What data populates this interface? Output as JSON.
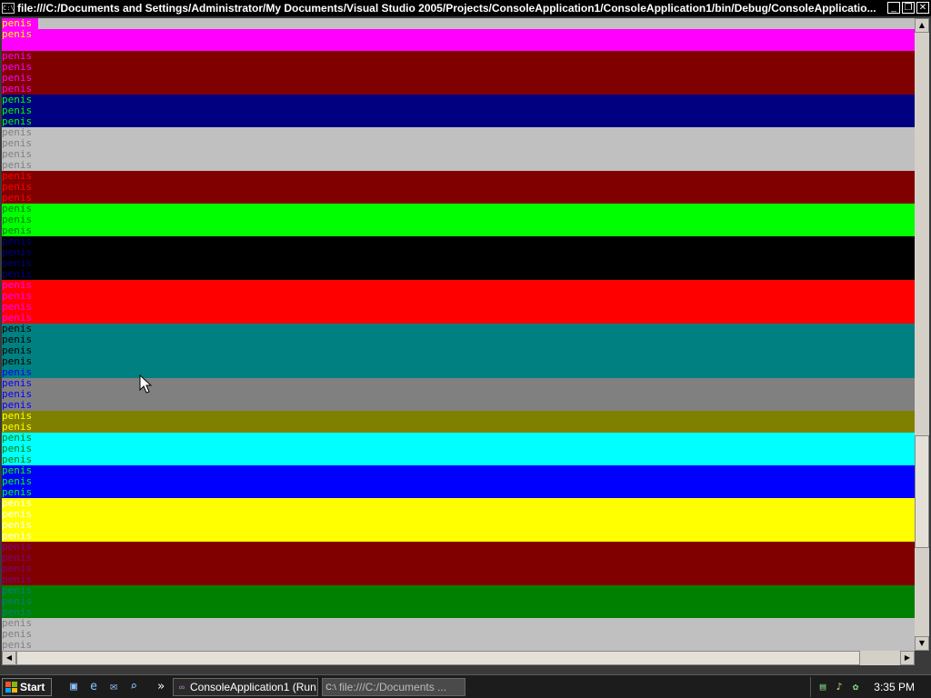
{
  "window": {
    "title": "file:///C:/Documents and Settings/Administrator/My Documents/Visual Studio 2005/Projects/ConsoleApplication1/ConsoleApplication1/bin/Debug/ConsoleApplicatio...",
    "icon": "console-icon",
    "icon_glyph": "C:\\",
    "buttons": {
      "minimize": "_",
      "restore": "❐",
      "close": "✕"
    }
  },
  "console": {
    "word": "penis",
    "start_row": 0,
    "bands": [
      {
        "color": "#c0c0c0",
        "lines": [
          {
            "fg": "#ffff00",
            "bg": "#ff00ff"
          }
        ]
      },
      {
        "color": "#ff00ff",
        "lines": [
          {
            "fg": "#ffff00",
            "bg": "#ff00ff"
          },
          {
            "fg": "#ff00ff",
            "bg": "#ff00ff"
          }
        ]
      },
      {
        "color": "#800000",
        "lines": [
          {
            "fg": "#ff00ff",
            "bg": "#800000"
          },
          {
            "fg": "#ff00ff",
            "bg": "#800000"
          },
          {
            "fg": "#ff00ff",
            "bg": "#800000"
          },
          {
            "fg": "#ff00ff",
            "bg": "#800000"
          }
        ]
      },
      {
        "color": "#000080",
        "lines": [
          {
            "fg": "#00ff00",
            "bg": "#000080"
          },
          {
            "fg": "#00ff00",
            "bg": "#000080"
          },
          {
            "fg": "#00ff00",
            "bg": "#000080"
          }
        ]
      },
      {
        "color": "#c0c0c0",
        "lines": [
          {
            "fg": "#808080",
            "bg": "#c0c0c0"
          },
          {
            "fg": "#808080",
            "bg": "#c0c0c0"
          },
          {
            "fg": "#808080",
            "bg": "#c0c0c0"
          },
          {
            "fg": "#808080",
            "bg": "#c0c0c0"
          }
        ]
      },
      {
        "color": "#800000",
        "lines": [
          {
            "fg": "#ff0000",
            "bg": "#800000"
          },
          {
            "fg": "#ff0000",
            "bg": "#800000"
          },
          {
            "fg": "#ff0000",
            "bg": "#800000"
          }
        ]
      },
      {
        "color": "#00ff00",
        "lines": [
          {
            "fg": "#008000",
            "bg": "#00ff00"
          },
          {
            "fg": "#008000",
            "bg": "#00ff00"
          },
          {
            "fg": "#008000",
            "bg": "#00ff00"
          }
        ]
      },
      {
        "color": "#000000",
        "lines": [
          {
            "fg": "#000080",
            "bg": "#000000"
          },
          {
            "fg": "#000080",
            "bg": "#000000"
          },
          {
            "fg": "#000080",
            "bg": "#000000"
          },
          {
            "fg": "#000080",
            "bg": "#000000"
          }
        ]
      },
      {
        "color": "#ff0000",
        "lines": [
          {
            "fg": "#ff00ff",
            "bg": "#ff0000"
          },
          {
            "fg": "#ff00ff",
            "bg": "#ff0000"
          },
          {
            "fg": "#ff00ff",
            "bg": "#ff0000"
          },
          {
            "fg": "#ff00ff",
            "bg": "#ff0000"
          }
        ]
      },
      {
        "color": "#008080",
        "lines": [
          {
            "fg": "#000000",
            "bg": "#008080"
          },
          {
            "fg": "#000000",
            "bg": "#008080"
          },
          {
            "fg": "#000000",
            "bg": "#008080"
          },
          {
            "fg": "#000000",
            "bg": "#008080"
          },
          {
            "fg": "#0000ff",
            "bg": "#008080"
          }
        ]
      },
      {
        "color": "#808080",
        "lines": [
          {
            "fg": "#0000ff",
            "bg": "#808080"
          },
          {
            "fg": "#0000ff",
            "bg": "#808080"
          },
          {
            "fg": "#0000ff",
            "bg": "#808080"
          }
        ]
      },
      {
        "color": "#808000",
        "lines": [
          {
            "fg": "#ffff00",
            "bg": "#808000"
          },
          {
            "fg": "#ffff00",
            "bg": "#808000"
          }
        ]
      },
      {
        "color": "#00ffff",
        "lines": [
          {
            "fg": "#008000",
            "bg": "#00ffff"
          },
          {
            "fg": "#008000",
            "bg": "#00ffff"
          },
          {
            "fg": "#008000",
            "bg": "#00ffff"
          }
        ]
      },
      {
        "color": "#0000ff",
        "lines": [
          {
            "fg": "#00ff00",
            "bg": "#0000ff"
          },
          {
            "fg": "#00ff00",
            "bg": "#0000ff"
          },
          {
            "fg": "#00ff00",
            "bg": "#0000ff"
          }
        ]
      },
      {
        "color": "#ffff00",
        "lines": [
          {
            "fg": "#ffffff",
            "bg": "#ffff00"
          },
          {
            "fg": "#ffffff",
            "bg": "#ffff00"
          },
          {
            "fg": "#ffffff",
            "bg": "#ffff00"
          },
          {
            "fg": "#ffffff",
            "bg": "#ffff00"
          }
        ]
      },
      {
        "color": "#800000",
        "lines": [
          {
            "fg": "#800080",
            "bg": "#800000"
          },
          {
            "fg": "#800080",
            "bg": "#800000"
          },
          {
            "fg": "#800080",
            "bg": "#800000"
          },
          {
            "fg": "#800080",
            "bg": "#800000"
          }
        ]
      },
      {
        "color": "#008000",
        "lines": [
          {
            "fg": "#008080",
            "bg": "#008000"
          },
          {
            "fg": "#008080",
            "bg": "#008000"
          },
          {
            "fg": "#008080",
            "bg": "#008000"
          }
        ]
      },
      {
        "color": "#c0c0c0",
        "lines": [
          {
            "fg": "#808080",
            "bg": "#c0c0c0"
          },
          {
            "fg": "#808080",
            "bg": "#c0c0c0"
          },
          {
            "fg": "#808080",
            "bg": "#c0c0c0"
          },
          {
            "fg": "#808080",
            "bg": "#c0c0c0"
          }
        ]
      }
    ]
  },
  "scrollbars": {
    "vertical_position": 0.82,
    "up_arrow": "▲",
    "down_arrow": "▼",
    "left_arrow": "◀",
    "right_arrow": "▶"
  },
  "taskbar": {
    "start_label": "Start",
    "start_flag_colors": [
      "#f35325",
      "#81bc06",
      "#05a6f0",
      "#ffba08"
    ],
    "quick_launch": [
      {
        "name": "show-desktop-icon",
        "glyph": "▣"
      },
      {
        "name": "internet-explorer-icon",
        "glyph": "e"
      },
      {
        "name": "outlook-icon",
        "glyph": "✉"
      },
      {
        "name": "search-icon",
        "glyph": "⌕"
      }
    ],
    "overflow_glyph": "»",
    "tasks": [
      {
        "label": "ConsoleApplication1 (Run...",
        "icon": "visual-studio-icon",
        "glyph": "∞",
        "active": false
      },
      {
        "label": "file:///C:/Documents ...",
        "icon": "console-icon",
        "glyph": "C:\\",
        "active": true
      }
    ],
    "tray_icons": [
      {
        "name": "network-icon",
        "glyph": "▤"
      },
      {
        "name": "volume-icon",
        "glyph": "♪"
      },
      {
        "name": "messenger-icon",
        "glyph": "✿"
      }
    ],
    "clock": "3:35 PM"
  }
}
